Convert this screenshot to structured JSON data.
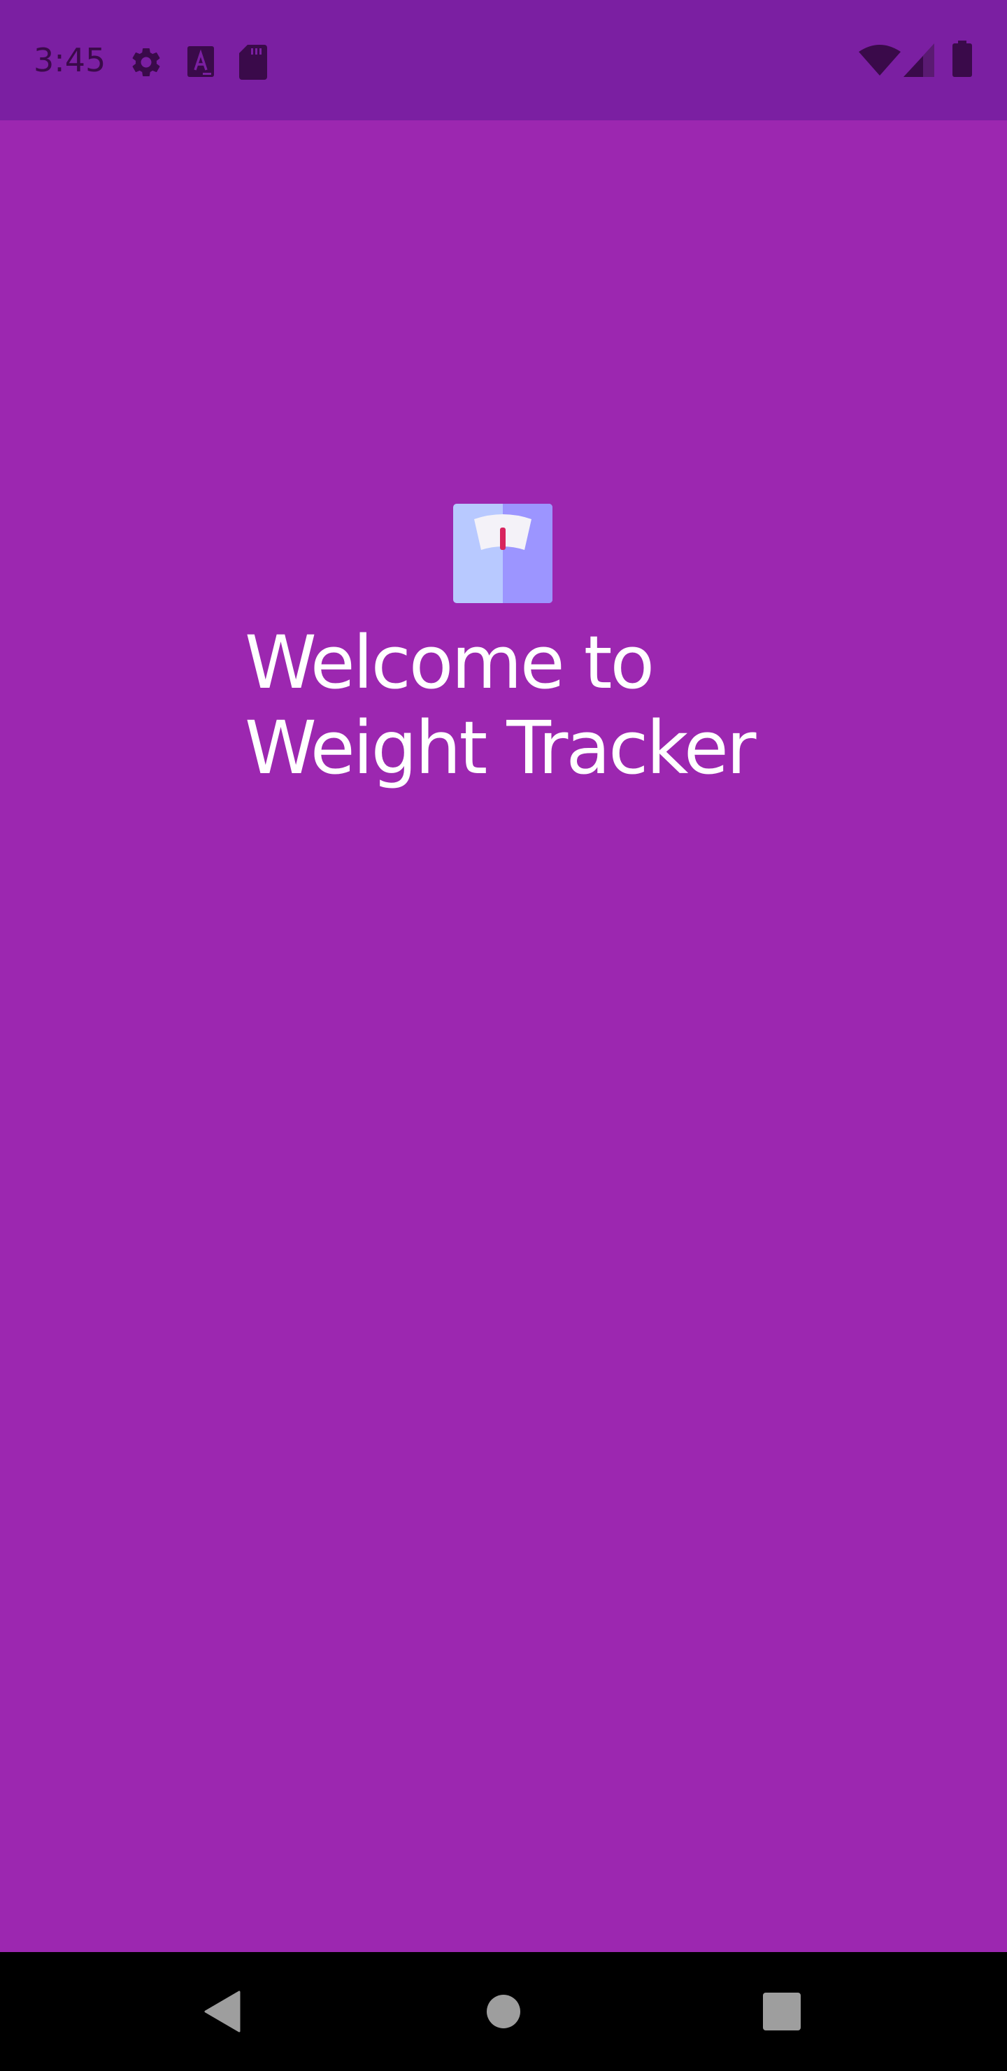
{
  "status_bar": {
    "time": "3:45",
    "left_icons": [
      "gear-icon",
      "font-a-icon",
      "sd-card-icon"
    ],
    "right_icons": [
      "wifi-icon",
      "cell-signal-icon",
      "battery-icon"
    ],
    "background_color": "#7B1FA2",
    "icon_color": "#3a0a4a"
  },
  "main": {
    "background_color": "#9C27B0",
    "logo_icon": "weighing-scale-icon",
    "welcome_line1": "Welcome to",
    "welcome_line2": "Weight Tracker",
    "text_color": "#FFFFFF"
  },
  "nav_bar": {
    "buttons": [
      "back-icon",
      "home-icon",
      "recents-icon"
    ],
    "background_color": "#000000",
    "icon_color": "#9E9E9E"
  }
}
